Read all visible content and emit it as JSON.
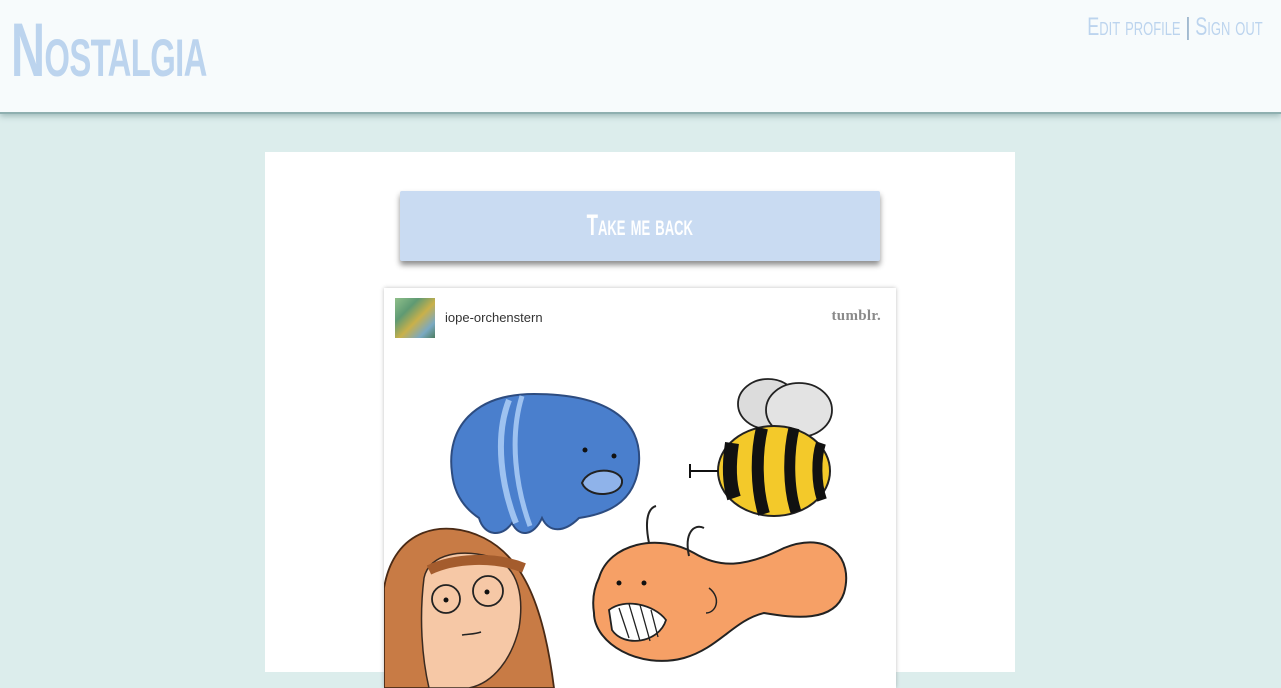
{
  "header": {
    "logo": "Nostalgia",
    "edit_profile": "Edit profile",
    "separator": "|",
    "sign_out": "Sign out"
  },
  "main": {
    "back_button": "Take me back"
  },
  "post": {
    "username": "iope-orchenstern",
    "platform": "tumblr."
  },
  "colors": {
    "background": "#dcedec",
    "header_bg": "#f7fbfc",
    "accent": "#bcd4ee",
    "button_bg": "#c9dbf2"
  }
}
